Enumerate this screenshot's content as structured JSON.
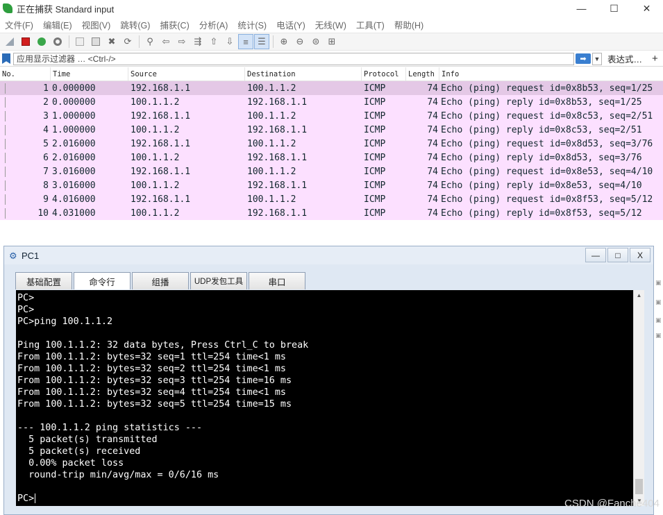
{
  "app": {
    "title": "正在捕获 Standard input",
    "window_controls": [
      "—",
      "☐",
      "✕"
    ]
  },
  "menubar": {
    "items": [
      "文件(F)",
      "编辑(E)",
      "视图(V)",
      "跳转(G)",
      "捕获(C)",
      "分析(A)",
      "统计(S)",
      "电话(Y)",
      "无线(W)",
      "工具(T)",
      "帮助(H)"
    ]
  },
  "filter": {
    "placeholder": "应用显示过滤器 … <Ctrl-/>",
    "expression_label": "表达式…",
    "plus_label": "+"
  },
  "packet_list": {
    "columns": [
      "No.",
      "Time",
      "Source",
      "Destination",
      "Protocol",
      "Length",
      "Info"
    ],
    "rows": [
      {
        "no": "1",
        "time": "0.000000",
        "src": "192.168.1.1",
        "dst": "100.1.1.2",
        "proto": "ICMP",
        "len": "74",
        "info": "Echo (ping) request  id=0x8b53, seq=1/25"
      },
      {
        "no": "2",
        "time": "0.000000",
        "src": "100.1.1.2",
        "dst": "192.168.1.1",
        "proto": "ICMP",
        "len": "74",
        "info": "Echo (ping) reply    id=0x8b53, seq=1/25"
      },
      {
        "no": "3",
        "time": "1.000000",
        "src": "192.168.1.1",
        "dst": "100.1.1.2",
        "proto": "ICMP",
        "len": "74",
        "info": "Echo (ping) request  id=0x8c53, seq=2/51"
      },
      {
        "no": "4",
        "time": "1.000000",
        "src": "100.1.1.2",
        "dst": "192.168.1.1",
        "proto": "ICMP",
        "len": "74",
        "info": "Echo (ping) reply    id=0x8c53, seq=2/51"
      },
      {
        "no": "5",
        "time": "2.016000",
        "src": "192.168.1.1",
        "dst": "100.1.1.2",
        "proto": "ICMP",
        "len": "74",
        "info": "Echo (ping) request  id=0x8d53, seq=3/76"
      },
      {
        "no": "6",
        "time": "2.016000",
        "src": "100.1.1.2",
        "dst": "192.168.1.1",
        "proto": "ICMP",
        "len": "74",
        "info": "Echo (ping) reply    id=0x8d53, seq=3/76"
      },
      {
        "no": "7",
        "time": "3.016000",
        "src": "192.168.1.1",
        "dst": "100.1.1.2",
        "proto": "ICMP",
        "len": "74",
        "info": "Echo (ping) request  id=0x8e53, seq=4/10"
      },
      {
        "no": "8",
        "time": "3.016000",
        "src": "100.1.1.2",
        "dst": "192.168.1.1",
        "proto": "ICMP",
        "len": "74",
        "info": "Echo (ping) reply    id=0x8e53, seq=4/10"
      },
      {
        "no": "9",
        "time": "4.016000",
        "src": "192.168.1.1",
        "dst": "100.1.1.2",
        "proto": "ICMP",
        "len": "74",
        "info": "Echo (ping) request  id=0x8f53, seq=5/12"
      },
      {
        "no": "10",
        "time": "4.031000",
        "src": "100.1.1.2",
        "dst": "192.168.1.1",
        "proto": "ICMP",
        "len": "74",
        "info": "Echo (ping) reply    id=0x8f53, seq=5/12"
      }
    ]
  },
  "pc_window": {
    "title": "PC1",
    "controls": [
      "—",
      "□",
      "X"
    ],
    "tabs": [
      "基础配置",
      "命令行",
      "组播",
      "UDP发包工具",
      "串口"
    ],
    "active_tab": "命令行",
    "terminal_lines": [
      "PC>",
      "PC>",
      "PC>ping 100.1.1.2",
      "",
      "Ping 100.1.1.2: 32 data bytes, Press Ctrl_C to break",
      "From 100.1.1.2: bytes=32 seq=1 ttl=254 time<1 ms",
      "From 100.1.1.2: bytes=32 seq=2 ttl=254 time<1 ms",
      "From 100.1.1.2: bytes=32 seq=3 ttl=254 time=16 ms",
      "From 100.1.1.2: bytes=32 seq=4 ttl=254 time<1 ms",
      "From 100.1.1.2: bytes=32 seq=5 ttl=254 time=15 ms",
      "",
      "--- 100.1.1.2 ping statistics ---",
      "  5 packet(s) transmitted",
      "  5 packet(s) received",
      "  0.00% packet loss",
      "  round-trip min/avg/max = 0/6/16 ms",
      "",
      "PC>"
    ]
  },
  "watermark": "CSDN @Fanche404",
  "colors": {
    "row_icmp": "#fce0ff",
    "row_selected": "#e4c8e6",
    "terminal_bg": "#000000",
    "terminal_fg": "#ffffff"
  }
}
